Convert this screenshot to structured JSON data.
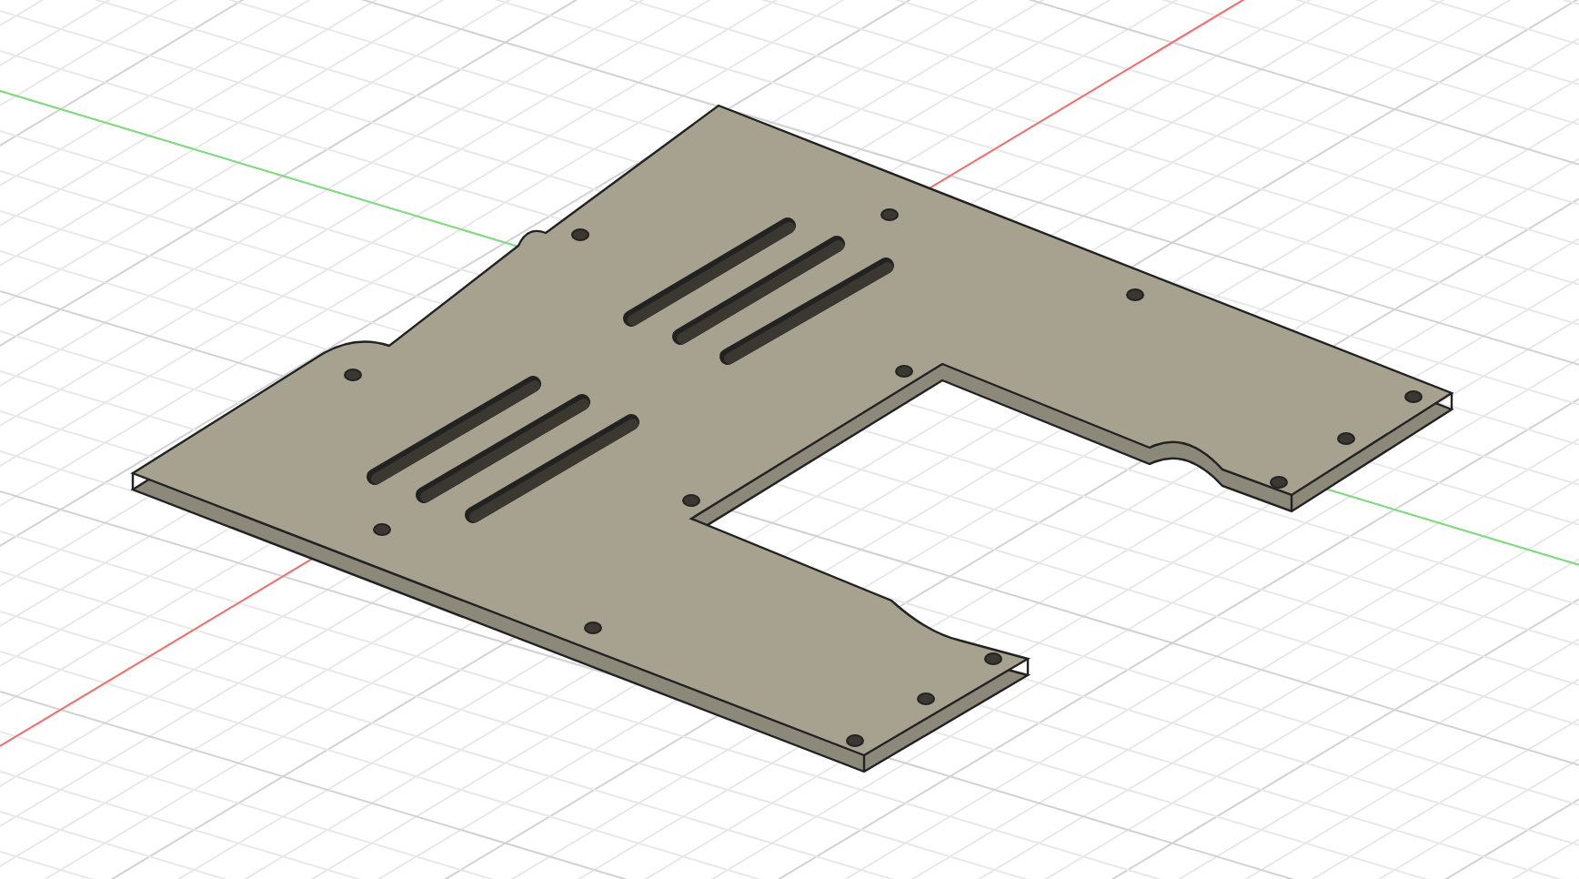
{
  "viewport": {
    "axes": [
      {
        "color": "#f07070"
      },
      {
        "color": "#7ddc7d"
      }
    ]
  }
}
